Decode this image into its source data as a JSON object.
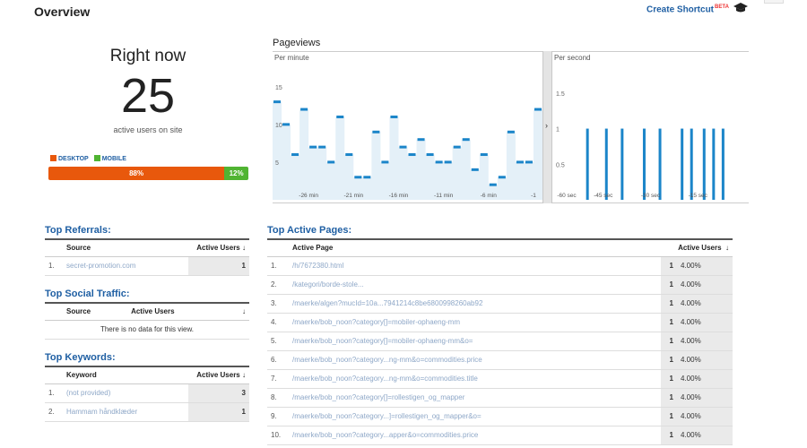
{
  "header": {
    "title": "Overview",
    "shortcut_label": "Create Shortcut",
    "shortcut_badge": "BETA"
  },
  "right_now": {
    "title": "Right now",
    "count": "25",
    "subtitle": "active users on site"
  },
  "devices": {
    "legend": [
      {
        "label": "DESKTOP",
        "color": "#e8580c"
      },
      {
        "label": "MOBILE",
        "color": "#50b432"
      }
    ],
    "segments": [
      {
        "label": "88%",
        "value": 88,
        "color": "#e8580c"
      },
      {
        "label": "12%",
        "value": 12,
        "color": "#50b432"
      }
    ]
  },
  "pageviews": {
    "title": "Pageviews",
    "per_minute_label": "Per minute",
    "per_second_label": "Per second"
  },
  "chart_data": [
    {
      "type": "area",
      "title": "Per minute",
      "ylim": [
        0,
        17
      ],
      "yticks": [
        5,
        10,
        15
      ],
      "xticks": [
        {
          "x": -26,
          "label": "-26 min"
        },
        {
          "x": -21,
          "label": "-21 min"
        },
        {
          "x": -16,
          "label": "-16 min"
        },
        {
          "x": -11,
          "label": "-11 min"
        },
        {
          "x": -6,
          "label": "-6 min"
        },
        {
          "x": -1,
          "label": "-1"
        }
      ],
      "x": [
        -30,
        -29,
        -28,
        -27,
        -26,
        -25,
        -24,
        -23,
        -22,
        -21,
        -20,
        -19,
        -18,
        -17,
        -16,
        -15,
        -14,
        -13,
        -12,
        -11,
        -10,
        -9,
        -8,
        -7,
        -6,
        -5,
        -4,
        -3,
        -2,
        -1,
        0
      ],
      "values": [
        13,
        10,
        6,
        12,
        7,
        7,
        5,
        11,
        6,
        3,
        3,
        9,
        5,
        11,
        7,
        6,
        8,
        6,
        5,
        5,
        7,
        8,
        4,
        6,
        2,
        3,
        9,
        5,
        5,
        12,
        0
      ],
      "grid": false
    },
    {
      "type": "bar",
      "title": "Per second",
      "ylim": [
        0,
        1.8
      ],
      "yticks": [
        0.5,
        1,
        1.5
      ],
      "xticks": [
        {
          "x": -60,
          "label": "-60 sec"
        },
        {
          "x": -45,
          "label": "-45 sec"
        },
        {
          "x": -30,
          "label": "-30 sec"
        },
        {
          "x": -15,
          "label": "-15 sec"
        }
      ],
      "x": [
        -50,
        -44,
        -39,
        -32,
        -27,
        -20,
        -17,
        -13,
        -10,
        -7
      ],
      "values": [
        1,
        1,
        1,
        1,
        1,
        1,
        1,
        1,
        1,
        1
      ],
      "grid": false
    }
  ],
  "top_referrals": {
    "title": "Top Referrals:",
    "columns": [
      "Source",
      "Active Users"
    ],
    "rows": [
      {
        "num": "1.",
        "source": "secret-promotion.com",
        "users": "1"
      }
    ]
  },
  "top_social": {
    "title": "Top Social Traffic:",
    "columns": [
      "Source",
      "Active Users"
    ],
    "empty": "There is no data for this view."
  },
  "top_keywords": {
    "title": "Top Keywords:",
    "columns": [
      "Keyword",
      "Active Users"
    ],
    "rows": [
      {
        "num": "1.",
        "keyword": "(not provided)",
        "users": "3"
      },
      {
        "num": "2.",
        "keyword": "Hammam håndklæder",
        "users": "1"
      }
    ]
  },
  "top_pages": {
    "title": "Top Active Pages:",
    "columns": [
      "Active Page",
      "Active Users"
    ],
    "rows": [
      {
        "num": "1.",
        "page": "/h/7672380.html",
        "users": "1",
        "pct": "4.00%"
      },
      {
        "num": "2.",
        "page": "/kategori/borde-stole...",
        "users": "1",
        "pct": "4.00%"
      },
      {
        "num": "3.",
        "page": "/maerke/algen?mucId=10a...7941214c8be6800998260ab92",
        "users": "1",
        "pct": "4.00%"
      },
      {
        "num": "4.",
        "page": "/maerke/bob_noon?category[]=mobiler-ophaeng-mm",
        "users": "1",
        "pct": "4.00%"
      },
      {
        "num": "5.",
        "page": "/maerke/bob_noon?category[]=mobiler-ophaeng-mm&o=",
        "users": "1",
        "pct": "4.00%"
      },
      {
        "num": "6.",
        "page": "/maerke/bob_noon?category...ng-mm&o=commodities.price",
        "users": "1",
        "pct": "4.00%"
      },
      {
        "num": "7.",
        "page": "/maerke/bob_noon?category...ng-mm&o=commodities.title",
        "users": "1",
        "pct": "4.00%"
      },
      {
        "num": "8.",
        "page": "/maerke/bob_noon?category[]=rollestigen_og_mapper",
        "users": "1",
        "pct": "4.00%"
      },
      {
        "num": "9.",
        "page": "/maerke/bob_noon?category...]=rollestigen_og_mapper&o=",
        "users": "1",
        "pct": "4.00%"
      },
      {
        "num": "10.",
        "page": "/maerke/bob_noon?category...apper&o=commodities.price",
        "users": "1",
        "pct": "4.00%"
      }
    ]
  },
  "icons": {
    "shortcut": "mortarboard-icon",
    "sort": "arrow-down-icon",
    "expand": "chevron-right-icon"
  }
}
